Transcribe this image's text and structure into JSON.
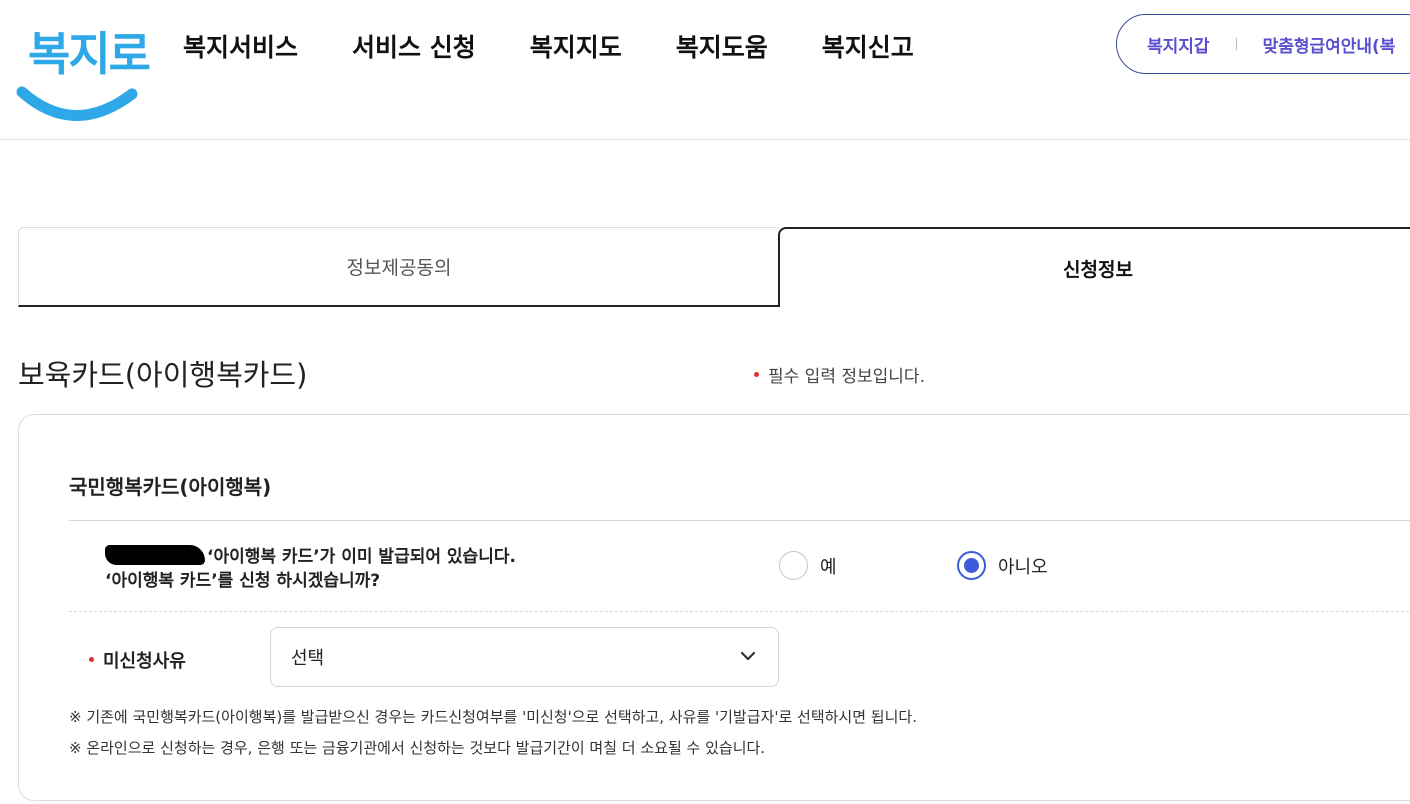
{
  "header": {
    "logo_text": "복지로",
    "nav": [
      "복지서비스",
      "서비스 신청",
      "복지지도",
      "복지도움",
      "복지신고"
    ],
    "util_links": [
      "복지지갑",
      "맞춤형급여안내(복"
    ]
  },
  "tabs": {
    "consent": "정보제공동의",
    "apply": "신청정보",
    "active": "apply"
  },
  "section": {
    "title": "보육카드(아이행복카드)",
    "required_note": "필수 입력 정보입니다."
  },
  "card": {
    "heading": "국민행복카드(아이행복)",
    "question_line1": "‘아이행복 카드’가 이미 발급되어 있습니다.",
    "question_line2": "‘아이행복 카드’를 신청 하시겠습니까?",
    "radio_yes": "예",
    "radio_no": "아니오",
    "selected": "no",
    "reason_label": "미신청사유",
    "reason_value": "선택",
    "note1": "※ 기존에 국민행복카드(아이행복)를 발급받으신 경우는 카드신청여부를 '미신청'으로 선택하고, 사유를 '기발급자'로 선택하시면 됩니다.",
    "note2": "※ 온라인으로 신청하는 경우, 은행 또는 금융기관에서 신청하는 것보다 발급기간이 며칠 더 소요될 수 있습니다."
  },
  "colors": {
    "accent_blue": "#3b5bdb",
    "logo_blue": "#2ea8e6",
    "util_purple": "#5b4fd1",
    "required_red": "#e03030"
  }
}
